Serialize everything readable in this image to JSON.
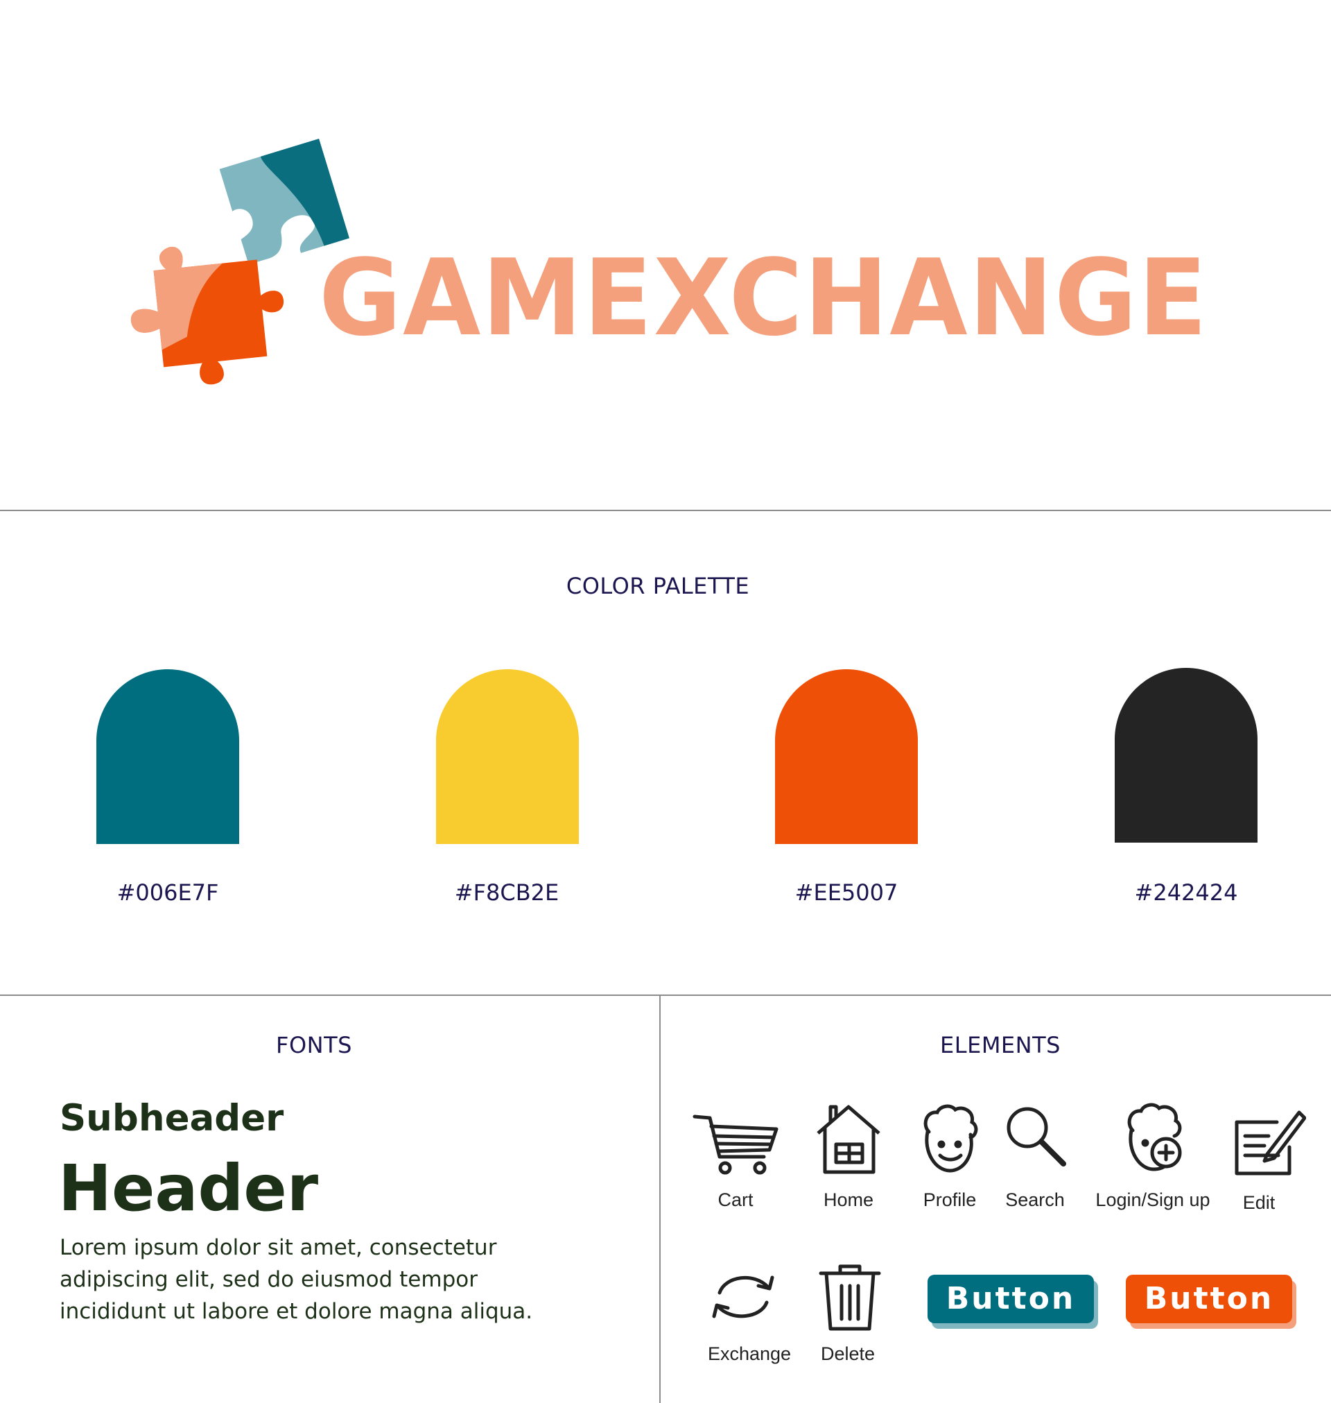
{
  "brand": {
    "name": "GAMEXCHANGE",
    "logo_icon": "puzzle-pieces-icon"
  },
  "palette": {
    "title": "COLOR PALETTE",
    "colors": [
      {
        "hex": "#006E7F"
      },
      {
        "hex": "#F8CB2E"
      },
      {
        "hex": "#EE5007"
      },
      {
        "hex": "#242424"
      }
    ]
  },
  "fonts": {
    "title": "FONTS",
    "subheader": "Subheader",
    "header": "Header",
    "body": "Lorem ipsum dolor sit amet, consectetur adipiscing elit, sed do eiusmod tempor incididunt ut labore et dolore magna aliqua."
  },
  "elements": {
    "title": "ELEMENTS",
    "icons": [
      {
        "label": "Cart",
        "icon": "cart-icon"
      },
      {
        "label": "Home",
        "icon": "home-icon"
      },
      {
        "label": "Profile",
        "icon": "profile-icon"
      },
      {
        "label": "Search",
        "icon": "search-icon"
      },
      {
        "label": "Login/Sign up",
        "icon": "login-signup-icon"
      },
      {
        "label": "Edit",
        "icon": "edit-icon"
      },
      {
        "label": "Exchange",
        "icon": "exchange-icon"
      },
      {
        "label": "Delete",
        "icon": "delete-icon"
      }
    ],
    "buttons": [
      {
        "label": "Button",
        "color": "#006E7F",
        "shadow": "#7fb6bf"
      },
      {
        "label": "Button",
        "color": "#EE5007",
        "shadow": "#f5a07c"
      }
    ]
  }
}
